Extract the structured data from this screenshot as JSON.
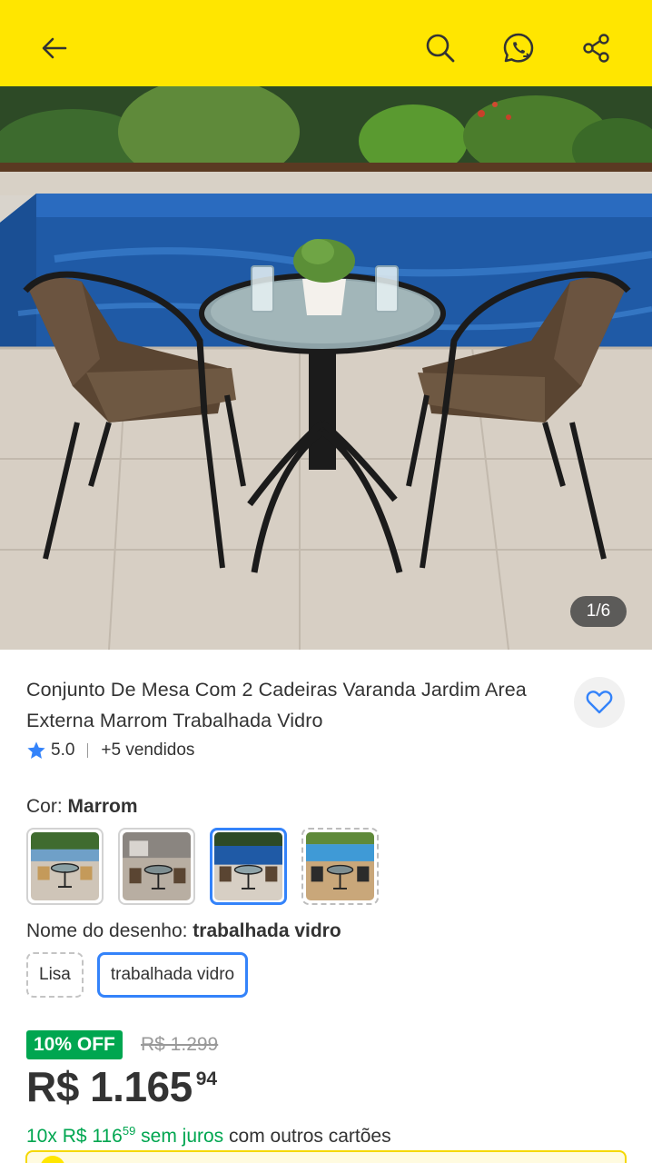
{
  "colors": {
    "header_bg": "#ffe600",
    "accent_blue": "#3483fa",
    "discount_green": "#00a650"
  },
  "header": {
    "icons": [
      "back-arrow-icon",
      "search-icon",
      "whatsapp-icon",
      "share-icon"
    ]
  },
  "gallery": {
    "counter": "1/6"
  },
  "product": {
    "title": "Conjunto De Mesa Com 2 Cadeiras Varanda Jardim Area Externa Marrom Trabalhada Vidro",
    "rating": "5.0",
    "sold": "+5 vendidos"
  },
  "color_picker": {
    "label": "Cor: ",
    "selected": "Marrom",
    "thumbnails": [
      {
        "state": "default"
      },
      {
        "state": "default"
      },
      {
        "state": "selected"
      },
      {
        "state": "dashed"
      }
    ]
  },
  "design_picker": {
    "label": "Nome do desenho: ",
    "selected": "trabalhada vidro",
    "options": [
      {
        "label": "Lisa",
        "state": "dashed"
      },
      {
        "label": "trabalhada vidro",
        "state": "selected"
      }
    ]
  },
  "price": {
    "discount_badge": "10% OFF",
    "old_price": "R$ 1.299",
    "current_main": "R$ 1.165",
    "current_cents": "94",
    "installments_prefix": "10x R$ 116",
    "installments_cents": "59",
    "installments_suffix": " sem juros",
    "installments_rest": " com outros cartões"
  }
}
